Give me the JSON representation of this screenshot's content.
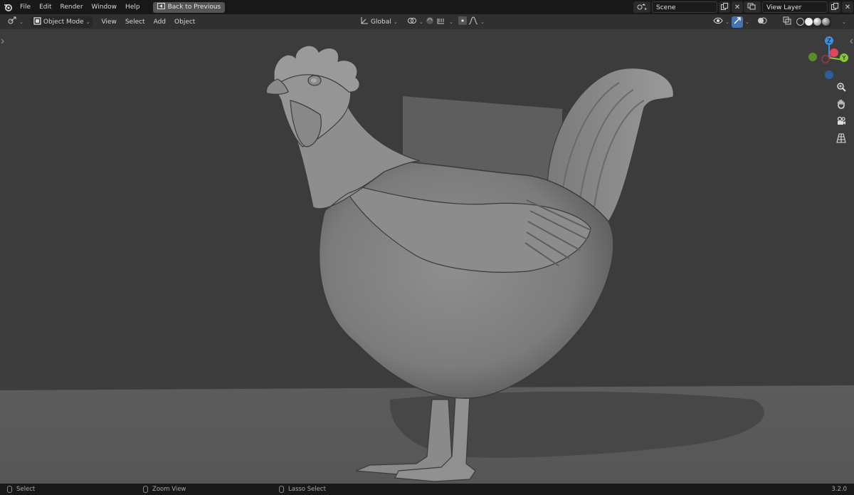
{
  "topbar": {
    "menu": [
      "File",
      "Edit",
      "Render",
      "Window",
      "Help"
    ],
    "back_button": "Back to Previous",
    "scene_name": "Scene",
    "view_layer_name": "View Layer"
  },
  "viewport_header": {
    "mode": "Object Mode",
    "menus": [
      "View",
      "Select",
      "Add",
      "Object"
    ],
    "transform_orientation": "Global"
  },
  "gizmo": {
    "axes": {
      "z": "Z",
      "y": "Y"
    },
    "colors": {
      "x": "#e2435f",
      "y": "#8cc43a",
      "z": "#3d8ee0"
    }
  },
  "statusbar": {
    "left_action": "Select",
    "middle_action": "Zoom View",
    "right_action": "Lasso Select",
    "version": "3.2.0"
  },
  "icons": {
    "logo": "blender-logo-icon",
    "back": "back-to-previous-icon",
    "editor_type": "editor-type-icon",
    "mode": "object-mode-icon",
    "orientation": "transform-orientation-icon",
    "pivot": "pivot-point-icon",
    "snap": "snap-icon",
    "proportional": "proportional-edit-icon",
    "visibility": "object-visibility-icon",
    "gizmo_toggle": "gizmo-toggle-icon",
    "overlay": "overlay-icon",
    "xray": "xray-icon",
    "zoom": "zoom-icon",
    "pan": "pan-hand-icon",
    "camera": "camera-view-icon",
    "ortho": "orthographic-grid-icon"
  }
}
